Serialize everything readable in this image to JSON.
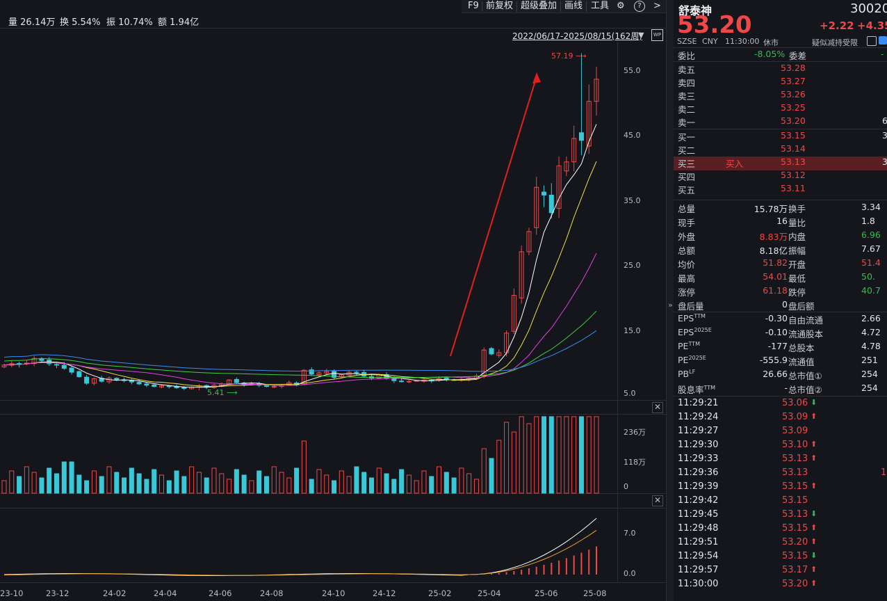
{
  "toolbar": {
    "f9": "F9",
    "adjust": "前复权",
    "overlay": "超级叠加",
    "draw": "画线",
    "tools": "工具",
    "help_icon": "?",
    "more": ">"
  },
  "stats": [
    {
      "label": "量",
      "value": "26.14万"
    },
    {
      "label": "换",
      "value": "5.54%"
    },
    {
      "label": "振",
      "value": "10.74%"
    },
    {
      "label": "额",
      "value": "1.94亿"
    }
  ],
  "range_label": "2022/06/17-2025/08/15(162周)",
  "price_axis": [
    "55.0",
    "45.0",
    "35.0",
    "25.0",
    "15.0",
    "5.0"
  ],
  "volume_axis": [
    "236万",
    "118万",
    "0"
  ],
  "macd_axis": [
    "7.0",
    "0.0"
  ],
  "x_axis": [
    "23-10",
    "23-12",
    "24-02",
    "24-04",
    "24-06",
    "24-08",
    "24-10",
    "24-12",
    "25-02",
    "25-04",
    "25-06",
    "25-08"
  ],
  "high_marker": "57.19",
  "low_marker": "5.41",
  "stock": {
    "name": "舒泰神",
    "code": "30020",
    "price": "53.20",
    "change": "+2.22",
    "change_pct": "+4.35",
    "exchange": "SZSE",
    "currency": "CNY",
    "time": "11:30:00",
    "status": "休市",
    "notice": "疑似减持受限"
  },
  "ratio": {
    "label": "委比",
    "value": "-8.05%",
    "diff_label": "委差",
    "diff_value": "-"
  },
  "asks": [
    {
      "label": "卖五",
      "price": "53.28",
      "qty": ""
    },
    {
      "label": "卖四",
      "price": "53.27",
      "qty": ""
    },
    {
      "label": "卖三",
      "price": "53.26",
      "qty": ""
    },
    {
      "label": "卖二",
      "price": "53.25",
      "qty": ""
    },
    {
      "label": "卖一",
      "price": "53.20",
      "qty": "6"
    }
  ],
  "bids": [
    {
      "label": "买一",
      "price": "53.15",
      "qty": "3",
      "tag": ""
    },
    {
      "label": "买二",
      "price": "53.14",
      "qty": "",
      "tag": ""
    },
    {
      "label": "买三",
      "price": "53.13",
      "qty": "3",
      "tag": "买入"
    },
    {
      "label": "买四",
      "price": "53.12",
      "qty": "",
      "tag": ""
    },
    {
      "label": "买五",
      "price": "53.11",
      "qty": "",
      "tag": ""
    }
  ],
  "quote_table": [
    {
      "l1": "总量",
      "v1": "15.78万",
      "c1": "white",
      "l2": "换手",
      "v2": "3.34",
      "c2": "white"
    },
    {
      "l1": "现手",
      "v1": "16",
      "c1": "white",
      "l2": "量比",
      "v2": "1.8",
      "c2": "white"
    },
    {
      "l1": "外盘",
      "v1": "8.83万",
      "c1": "red",
      "l2": "内盘",
      "v2": "6.96",
      "c2": "green"
    },
    {
      "l1": "总额",
      "v1": "8.18亿",
      "c1": "white",
      "l2": "振幅",
      "v2": "7.67",
      "c2": "white"
    },
    {
      "l1": "均价",
      "v1": "51.82",
      "c1": "red",
      "l2": "开盘",
      "v2": "51.4",
      "c2": "red"
    },
    {
      "l1": "最高",
      "v1": "54.01",
      "c1": "red",
      "l2": "最低",
      "v2": "50.",
      "c2": "green"
    },
    {
      "l1": "涨停",
      "v1": "61.18",
      "c1": "red",
      "l2": "跌停",
      "v2": "40.7",
      "c2": "green"
    },
    {
      "l1": "盘后量",
      "v1": "0",
      "c1": "white",
      "l2": "盘后额",
      "v2": "",
      "c2": "white"
    }
  ],
  "fundamentals": [
    {
      "l1": "EPS",
      "s1": "TTM",
      "v1": "-0.30",
      "l2": "自由流通",
      "v2": "2.66"
    },
    {
      "l1": "EPS",
      "s1": "2025E",
      "v1": "-0.10",
      "l2": "流通股本",
      "v2": "4.72"
    },
    {
      "l1": "PE",
      "s1": "TTM",
      "v1": "-177",
      "l2": "总股本",
      "v2": "4.78"
    },
    {
      "l1": "PE",
      "s1": "2025E",
      "v1": "-555.9",
      "l2": "流通值",
      "v2": "251"
    },
    {
      "l1": "PB",
      "s1": "LF",
      "v1": "26.66",
      "l2": "总市值①",
      "v2": "254"
    },
    {
      "l1": "股息率",
      "s1": "TTM",
      "v1": "-",
      "l2": "总市值②",
      "v2": "254"
    }
  ],
  "ticks": [
    {
      "time": "11:29:21",
      "price": "53.06",
      "dir": "down",
      "qty": ""
    },
    {
      "time": "11:29:24",
      "price": "53.09",
      "dir": "up",
      "qty": ""
    },
    {
      "time": "11:29:27",
      "price": "53.09",
      "dir": "",
      "qty": ""
    },
    {
      "time": "11:29:30",
      "price": "53.10",
      "dir": "up",
      "qty": ""
    },
    {
      "time": "11:29:33",
      "price": "53.13",
      "dir": "up",
      "qty": ""
    },
    {
      "time": "11:29:36",
      "price": "53.13",
      "dir": "",
      "qty": "1"
    },
    {
      "time": "11:29:39",
      "price": "53.15",
      "dir": "up",
      "qty": ""
    },
    {
      "time": "11:29:42",
      "price": "53.15",
      "dir": "",
      "qty": ""
    },
    {
      "time": "11:29:45",
      "price": "53.13",
      "dir": "down",
      "qty": ""
    },
    {
      "time": "11:29:48",
      "price": "53.15",
      "dir": "up",
      "qty": ""
    },
    {
      "time": "11:29:51",
      "price": "53.20",
      "dir": "up",
      "qty": ""
    },
    {
      "time": "11:29:54",
      "price": "53.15",
      "dir": "down",
      "qty": ""
    },
    {
      "time": "11:29:57",
      "price": "53.17",
      "dir": "up",
      "qty": ""
    },
    {
      "time": "11:30:00",
      "price": "53.20",
      "dir": "up",
      "qty": ""
    }
  ],
  "chart_data": {
    "type": "candlestick",
    "title": "",
    "period": "weekly",
    "ylim": [
      5,
      57.19
    ],
    "series_colors": {
      "up": "#f04848",
      "down": "#3ac8d8",
      "ma1": "#ffffff",
      "ma2": "#f0e040",
      "ma3": "#e040e0",
      "ma4": "#40d040",
      "ma5": "#3a8cf0"
    },
    "weekly_close": [
      9.3,
      9.5,
      9.4,
      9.6,
      10.3,
      10.0,
      9.5,
      9.3,
      8.8,
      8.2,
      7.5,
      6.5,
      7.2,
      6.8,
      7.3,
      7.0,
      6.9,
      6.7,
      6.4,
      6.2,
      6.0,
      6.1,
      6.0,
      5.8,
      5.7,
      5.9,
      6.1,
      5.9,
      6.2,
      6.4,
      7.0,
      6.6,
      6.3,
      6.4,
      6.2,
      6.0,
      6.0,
      6.2,
      6.6,
      6.3,
      8.5,
      7.9,
      8.1,
      8.3,
      7.4,
      7.8,
      8.2,
      8.1,
      7.6,
      7.3,
      7.8,
      7.3,
      6.9,
      6.8,
      6.8,
      6.9,
      7.0,
      6.9,
      7.2,
      7.1,
      7.0,
      7.1,
      7.3,
      7.6,
      11.6,
      11.0,
      11.2,
      14.2,
      20.0,
      26.7,
      29.8,
      36.6,
      35.4,
      32.7,
      39.9,
      40.5,
      44.1,
      43.8,
      49.8,
      53.2
    ],
    "high": 57.19,
    "low": 5.41
  }
}
